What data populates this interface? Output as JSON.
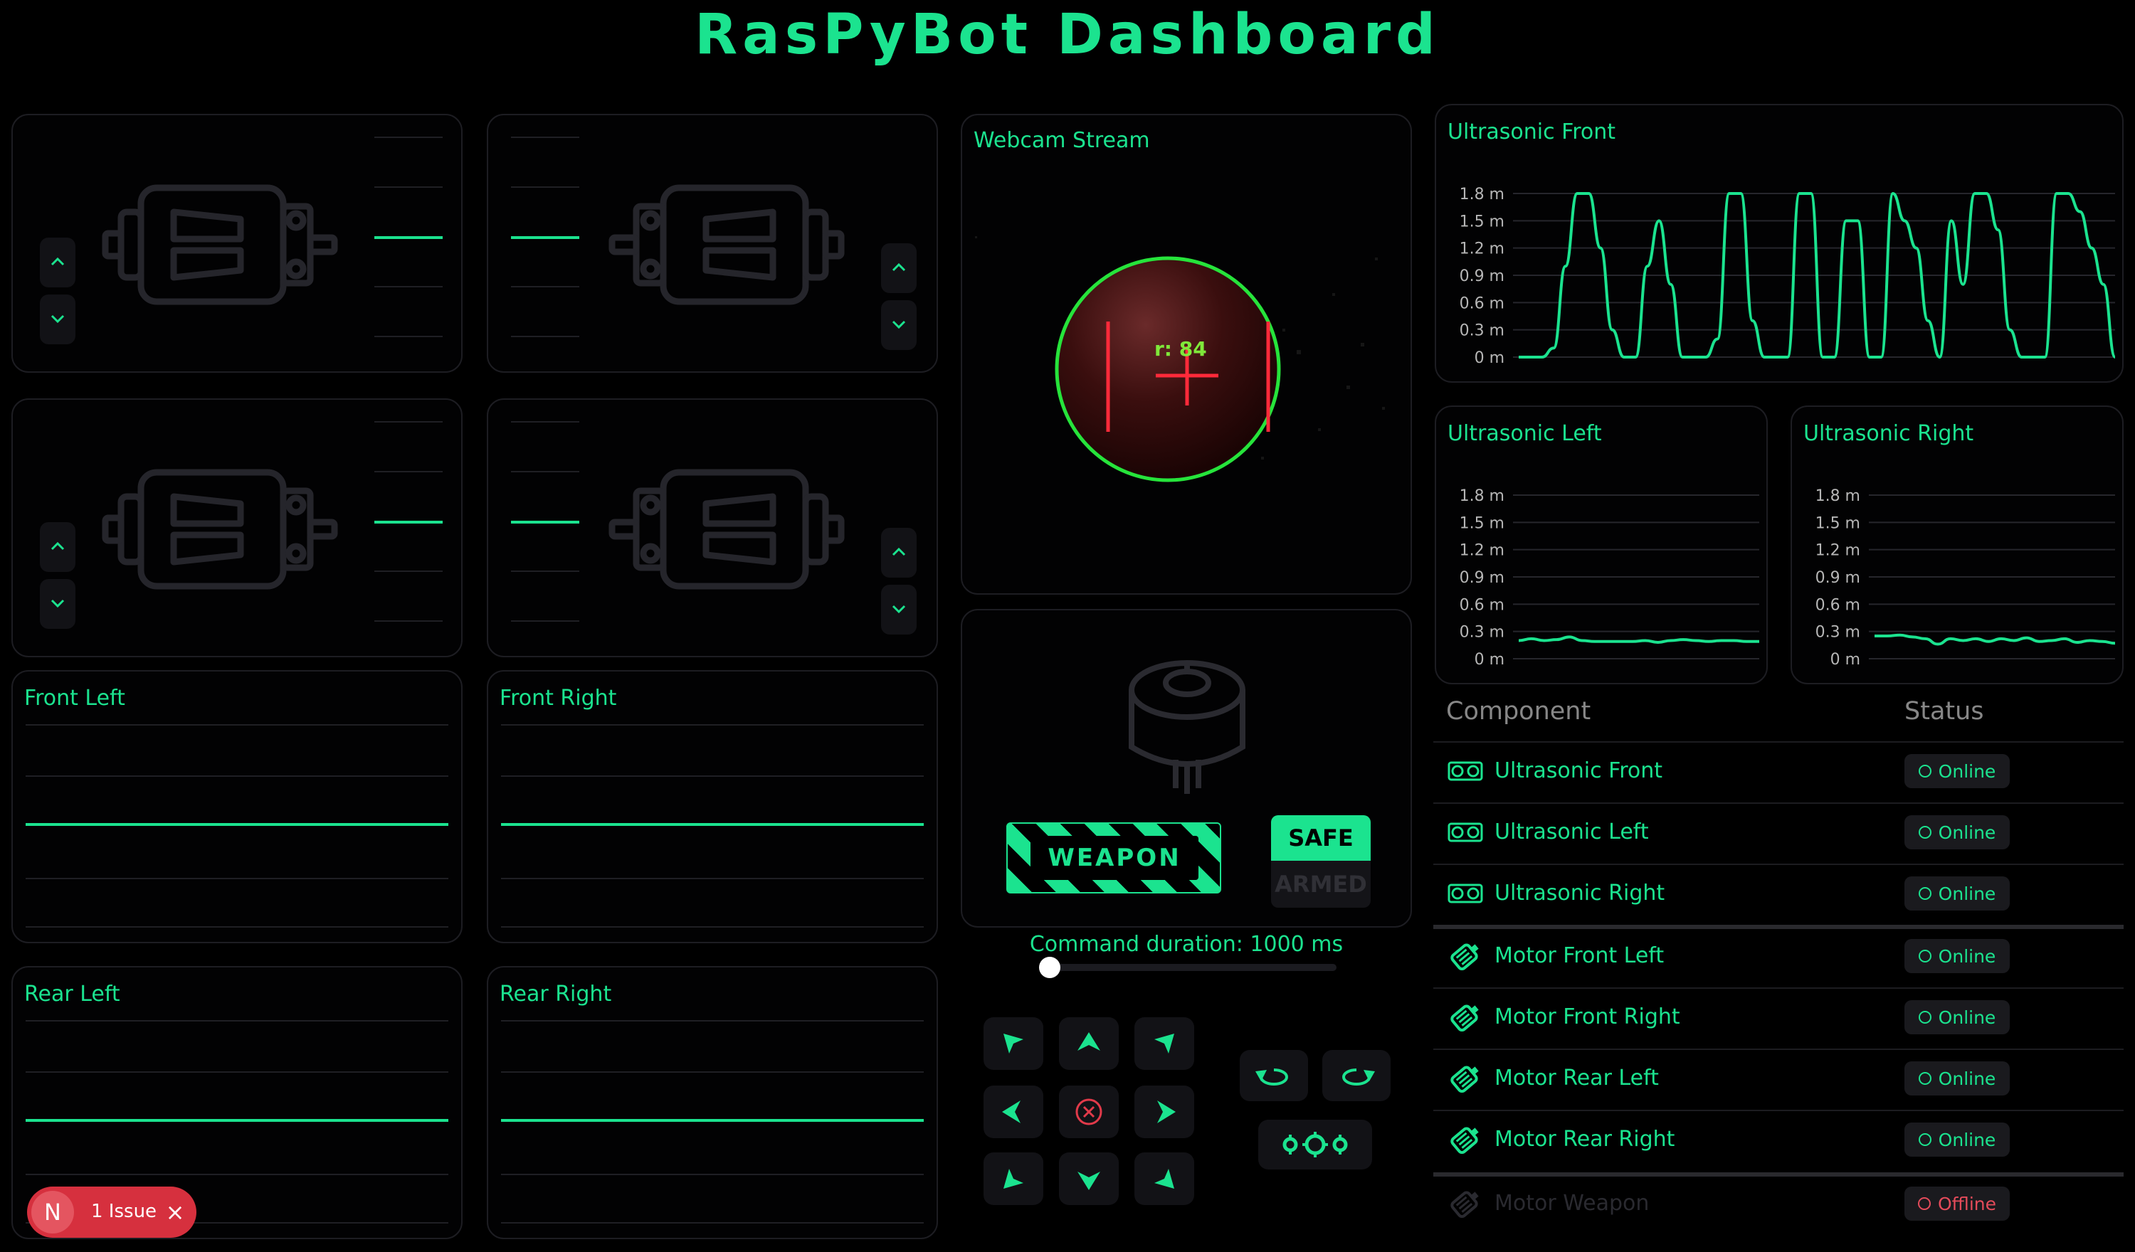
{
  "header": {
    "title": "RasPyBot  Dashboard"
  },
  "motor_panels": {
    "front_left": "Front Left",
    "front_right": "Front Right",
    "rear_left": "Rear Left",
    "rear_right": "Rear Right"
  },
  "webcam": {
    "title": "Webcam Stream",
    "overlay_label": "r: 84"
  },
  "weapon": {
    "button_label": "WEAPON",
    "safe_label": "SAFE",
    "armed_label": "ARMED",
    "state": "SAFE"
  },
  "command": {
    "label": "Command duration: 1000 ms",
    "duration_ms": 1000,
    "slider_fraction": 0.0
  },
  "sensors": {
    "front": {
      "title": "Ultrasonic Front"
    },
    "left": {
      "title": "Ultrasonic Left"
    },
    "right": {
      "title": "Ultrasonic Right"
    },
    "ticks": [
      "1.8 m",
      "1.5 m",
      "1.2 m",
      "0.9 m",
      "0.6 m",
      "0.3 m",
      "0 m"
    ]
  },
  "chart_data": [
    {
      "type": "line",
      "title": "Ultrasonic Front",
      "yticks": [
        "0 m",
        "0.3 m",
        "0.6 m",
        "0.9 m",
        "1.2 m",
        "1.5 m",
        "1.8 m"
      ],
      "ylim": [
        0,
        1.8
      ],
      "series": [
        {
          "values": [
            0,
            0,
            0,
            0.1,
            1.0,
            1.8,
            1.8,
            1.2,
            0.3,
            0,
            0,
            1.0,
            1.5,
            0.8,
            0,
            0,
            0,
            0.2,
            1.8,
            1.8,
            0.4,
            0,
            0,
            0,
            1.8,
            1.8,
            0,
            0,
            1.5,
            1.5,
            0,
            0,
            1.8,
            1.5,
            1.2,
            0.4,
            0,
            1.5,
            0.8,
            1.8,
            1.8,
            1.4,
            0.3,
            0,
            0,
            0,
            1.8,
            1.8,
            1.6,
            1.2,
            0.8,
            0
          ]
        }
      ]
    },
    {
      "type": "line",
      "title": "Ultrasonic Left",
      "yticks": [
        "0 m",
        "0.3 m",
        "0.6 m",
        "0.9 m",
        "1.2 m",
        "1.5 m",
        "1.8 m"
      ],
      "ylim": [
        0,
        1.8
      ],
      "series": [
        {
          "values": [
            0.2,
            0.22,
            0.2,
            0.21,
            0.24,
            0.2,
            0.19,
            0.19,
            0.19,
            0.19,
            0.2,
            0.18,
            0.2,
            0.21,
            0.2,
            0.19,
            0.2,
            0.2,
            0.19,
            0.19
          ]
        }
      ]
    },
    {
      "type": "line",
      "title": "Ultrasonic Right",
      "yticks": [
        "0 m",
        "0.3 m",
        "0.6 m",
        "0.9 m",
        "1.2 m",
        "1.5 m",
        "1.8 m"
      ],
      "ylim": [
        0,
        1.8
      ],
      "series": [
        {
          "values": [
            0.25,
            0.25,
            0.26,
            0.24,
            0.22,
            0.16,
            0.22,
            0.2,
            0.22,
            0.19,
            0.22,
            0.2,
            0.23,
            0.19,
            0.2,
            0.22,
            0.18,
            0.2,
            0.19,
            0.17
          ]
        }
      ]
    }
  ],
  "components": {
    "header_component": "Component",
    "header_status": "Status",
    "rows": [
      {
        "name": "Ultrasonic Front",
        "status": "Online",
        "kind": "sensor"
      },
      {
        "name": "Ultrasonic Left",
        "status": "Online",
        "kind": "sensor"
      },
      {
        "name": "Ultrasonic Right",
        "status": "Online",
        "kind": "sensor"
      },
      {
        "name": "Motor Front Left",
        "status": "Online",
        "kind": "motor"
      },
      {
        "name": "Motor Front Right",
        "status": "Online",
        "kind": "motor"
      },
      {
        "name": "Motor Rear Left",
        "status": "Online",
        "kind": "motor"
      },
      {
        "name": "Motor Rear Right",
        "status": "Online",
        "kind": "motor"
      },
      {
        "name": "Motor Weapon",
        "status": "Offline",
        "kind": "motor"
      }
    ]
  },
  "issues": {
    "avatar": "N",
    "label": "1 Issue"
  },
  "colors": {
    "accent": "#1be38f",
    "danger": "#e44b5a",
    "panel_border": "#1d1d22"
  }
}
